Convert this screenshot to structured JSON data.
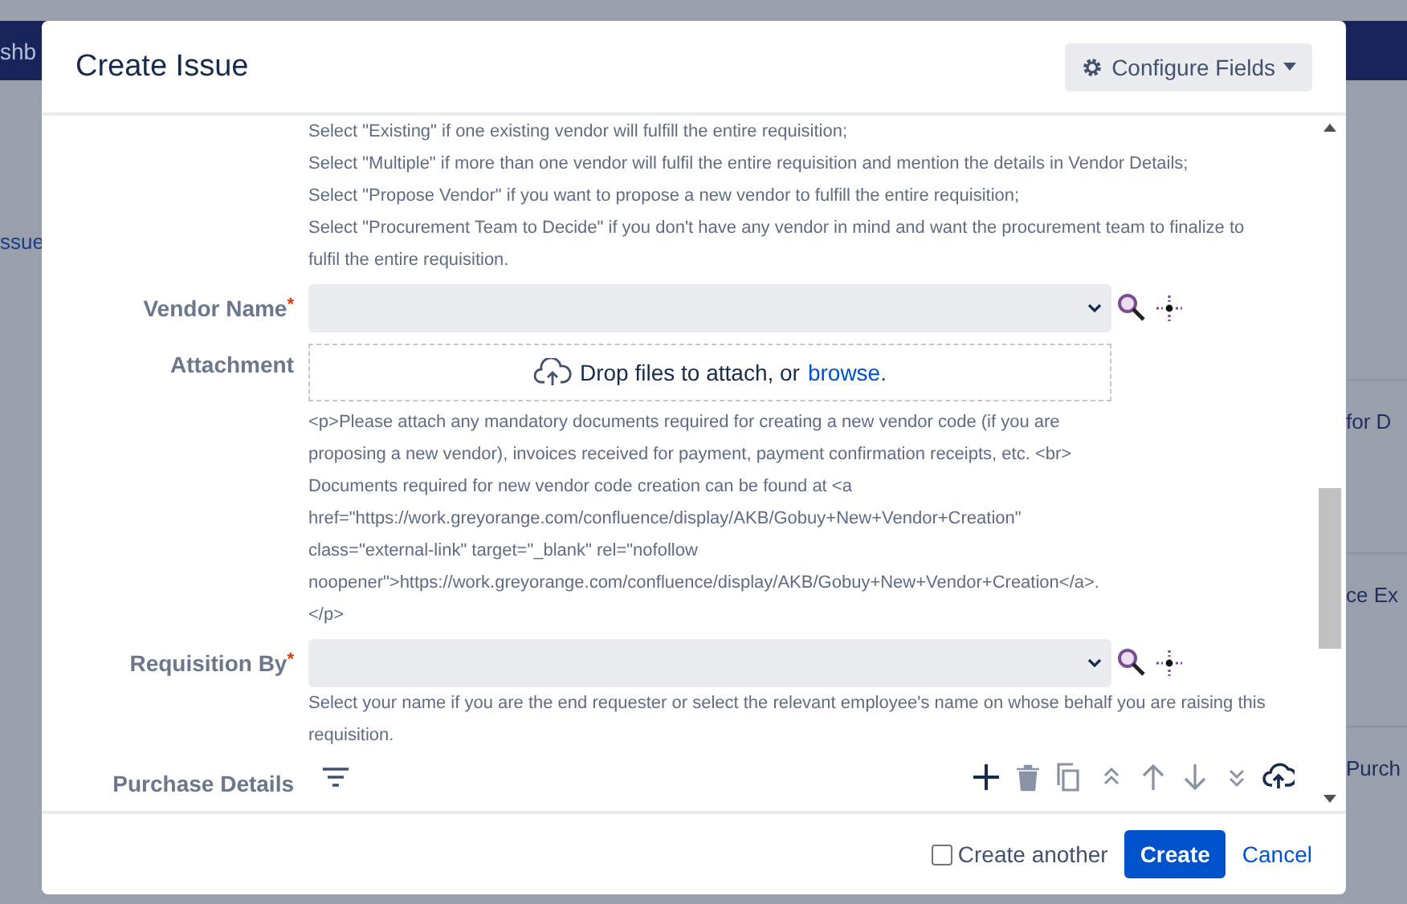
{
  "background": {
    "nav_text": "shb",
    "left_link": "ssue",
    "cards": [
      "for D",
      "ce Ex",
      "Purch"
    ]
  },
  "dialog": {
    "title": "Create Issue",
    "configure_button": "Configure Fields",
    "required_mark": "*",
    "intro_help": [
      "Select \"Existing\" if one existing vendor will fulfill the entire requisition;",
      "Select \"Multiple\" if more than one vendor will fulfil the entire requisition and mention the details in Vendor Details;",
      "Select \"Propose Vendor\" if you want to propose a new vendor to fulfill the entire requisition;",
      "Select \"Procurement Team to Decide\" if you don't have any vendor in mind and want the procurement team to finalize to",
      "fulfil the entire requisition."
    ],
    "fields": [
      {
        "kind": "select",
        "label": "Vendor Name",
        "required": true
      },
      {
        "kind": "attachment",
        "label": "Attachment",
        "required": false,
        "drop_text": "Drop files to attach, or",
        "browse_link": "browse.",
        "help": [
          "<p>Please attach any mandatory documents required for creating a new vendor code (if you are",
          "proposing a new vendor), invoices received for payment, payment confirmation receipts, etc. <br>",
          "Documents required for new vendor code creation can be found at <a",
          "href=\"https://work.greyorange.com/confluence/display/AKB/Gobuy+New+Vendor+Creation\"",
          "class=\"external-link\" target=\"_blank\" rel=\"nofollow",
          "noopener\">https://work.greyorange.com/confluence/display/AKB/Gobuy+New+Vendor+Creation</a>.",
          "</p>"
        ]
      },
      {
        "kind": "select",
        "label": "Requisition By",
        "required": true,
        "help": [
          "Select your name if you are the end requester or select the relevant employee's name on whose behalf you are raising this",
          "requisition."
        ]
      },
      {
        "kind": "table",
        "label": "Purchase Details",
        "required": false
      }
    ],
    "footer": {
      "create_another": {
        "label": "Create another",
        "checked": false
      },
      "create_button": "Create",
      "cancel_link": "Cancel"
    }
  }
}
